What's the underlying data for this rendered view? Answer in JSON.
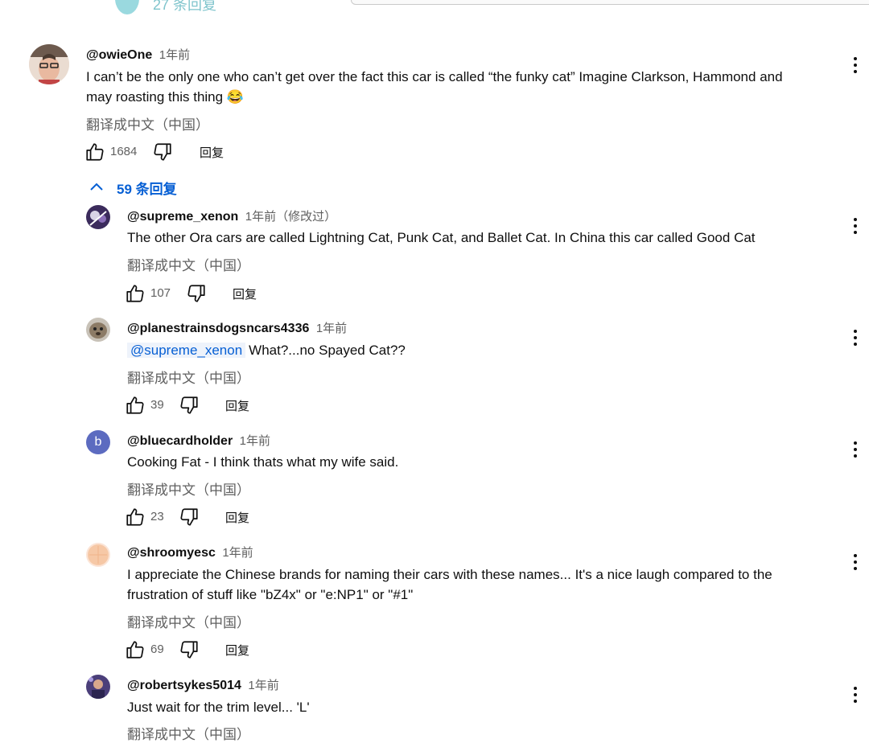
{
  "top_partial": {
    "label": "27 条回复"
  },
  "main_comment": {
    "author": "@owieOne",
    "time": "1年前",
    "text_line1": "I can’t be the only one who can’t get over the fact this car is called “the funky cat” Imagine Clarkson, Hammond and",
    "text_line2": "may roasting this thing 😂",
    "translate": "翻译成中文（中国）",
    "likes": "1684",
    "reply_label": "回复",
    "replies_toggle": "59 条回复"
  },
  "replies": [
    {
      "author": "@supreme_xenon",
      "time": "1年前（修改过）",
      "text": "The other Ora cars are called Lightning Cat, Punk Cat, and Ballet Cat. In China this car called Good Cat",
      "translate": "翻译成中文（中国）",
      "likes": "107",
      "reply_label": "回复"
    },
    {
      "author": "@planestrainsdogsncars4336",
      "time": "1年前",
      "mention": "@supreme_xenon",
      "text": "What?...no Spayed Cat??",
      "translate": "翻译成中文（中国）",
      "likes": "39",
      "reply_label": "回复"
    },
    {
      "author": "@bluecardholder",
      "time": "1年前",
      "avatar_letter": "b",
      "text": "Cooking Fat - I think thats what my wife said.",
      "translate": "翻译成中文（中国）",
      "likes": "23",
      "reply_label": "回复"
    },
    {
      "author": "@shroomyesc",
      "time": "1年前",
      "text_line1": "I appreciate the Chinese brands for naming their cars with these names... It's a nice laugh compared to the",
      "text_line2": "frustration of stuff like \"bZ4x\" or \"e:NP1\" or \"#1\"",
      "translate": "翻译成中文（中国）",
      "likes": "69",
      "reply_label": "回复"
    },
    {
      "author": "@robertsykes5014",
      "time": "1年前",
      "text": "Just wait for the trim level... 'L'",
      "translate": "翻译成中文（中国）"
    }
  ],
  "colors": {
    "link_blue": "#065fd4",
    "secondary_text": "#606060",
    "avatar_b_bg": "#5c6bc0"
  },
  "icons": [
    "thumb-up-icon",
    "thumb-down-icon",
    "more-vert-icon",
    "chevron-up-icon"
  ]
}
